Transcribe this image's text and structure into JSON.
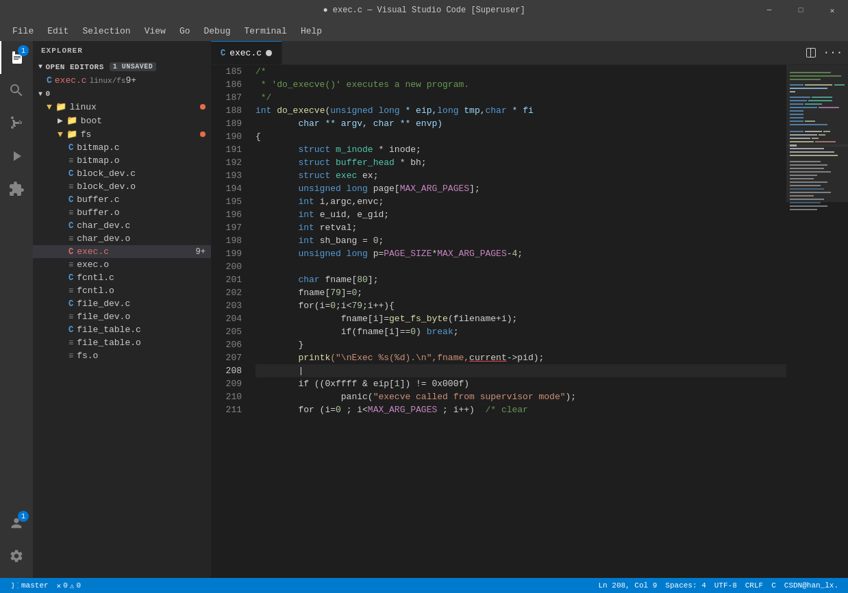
{
  "titlebar": {
    "title": "● exec.c — Visual Studio Code [Superuser]",
    "controls": [
      "minimize",
      "maximize",
      "close"
    ]
  },
  "menubar": {
    "items": [
      "File",
      "Edit",
      "Selection",
      "View",
      "Go",
      "Debug",
      "Terminal",
      "Help"
    ]
  },
  "activitybar": {
    "icons": [
      {
        "name": "explorer-icon",
        "glyph": "⎘",
        "active": true,
        "badge": "1"
      },
      {
        "name": "search-icon",
        "glyph": "🔍",
        "active": false
      },
      {
        "name": "source-control-icon",
        "glyph": "⑂",
        "active": false
      },
      {
        "name": "extensions-icon",
        "glyph": "⊞",
        "active": false
      },
      {
        "name": "remote-icon",
        "glyph": "⚙",
        "active": false
      }
    ],
    "bottom_icons": [
      {
        "name": "account-icon",
        "glyph": "👤",
        "badge": "1"
      },
      {
        "name": "settings-icon",
        "glyph": "⚙"
      }
    ]
  },
  "sidebar": {
    "title": "EXPLORER",
    "open_editors": {
      "label": "OPEN EDITORS",
      "badge": "1 UNSAVED",
      "items": [
        {
          "name": "exec.c",
          "path": "linux/fs",
          "modified": true,
          "unsaved_count": "9+"
        }
      ]
    },
    "tree": {
      "root": "0",
      "items": [
        {
          "level": 0,
          "type": "folder",
          "name": "linux",
          "expanded": true,
          "has_dot": true
        },
        {
          "level": 1,
          "type": "folder",
          "name": "boot",
          "expanded": false
        },
        {
          "level": 1,
          "type": "folder",
          "name": "fs",
          "expanded": true,
          "has_dot": true
        },
        {
          "level": 2,
          "type": "c-file",
          "name": "bitmap.c"
        },
        {
          "level": 2,
          "type": "o-file",
          "name": "bitmap.o"
        },
        {
          "level": 2,
          "type": "c-file",
          "name": "block_dev.c"
        },
        {
          "level": 2,
          "type": "o-file",
          "name": "block_dev.o"
        },
        {
          "level": 2,
          "type": "c-file",
          "name": "buffer.c"
        },
        {
          "level": 2,
          "type": "o-file",
          "name": "buffer.o"
        },
        {
          "level": 2,
          "type": "c-file",
          "name": "char_dev.c"
        },
        {
          "level": 2,
          "type": "o-file",
          "name": "char_dev.o"
        },
        {
          "level": 2,
          "type": "c-file",
          "name": "exec.c",
          "active": true,
          "unsaved_count": "9+"
        },
        {
          "level": 2,
          "type": "o-file",
          "name": "exec.o"
        },
        {
          "level": 2,
          "type": "c-file",
          "name": "fcntl.c"
        },
        {
          "level": 2,
          "type": "o-file",
          "name": "fcntl.o"
        },
        {
          "level": 2,
          "type": "c-file",
          "name": "file_dev.c"
        },
        {
          "level": 2,
          "type": "o-file",
          "name": "file_dev.o"
        },
        {
          "level": 2,
          "type": "c-file",
          "name": "file_table.c"
        },
        {
          "level": 2,
          "type": "o-file",
          "name": "file_table.o"
        },
        {
          "level": 2,
          "type": "o-file",
          "name": "fs.o"
        }
      ]
    }
  },
  "editor": {
    "tab": {
      "filename": "exec.c",
      "modified": true
    },
    "lines": [
      {
        "num": 185,
        "tokens": [
          {
            "text": "/*",
            "cls": "c-comment"
          }
        ]
      },
      {
        "num": 186,
        "tokens": [
          {
            "text": " * 'do_execve()' executes a new program.",
            "cls": "c-comment"
          }
        ]
      },
      {
        "num": 187,
        "tokens": [
          {
            "text": " */",
            "cls": "c-comment"
          }
        ]
      },
      {
        "num": 188,
        "tokens": [
          {
            "text": "int ",
            "cls": "c-keyword"
          },
          {
            "text": "do_execve",
            "cls": "c-function"
          },
          {
            "text": "(",
            "cls": ""
          },
          {
            "text": "unsigned long",
            "cls": "c-keyword"
          },
          {
            "text": " * eip,",
            "cls": "c-param"
          },
          {
            "text": "long",
            "cls": "c-keyword"
          },
          {
            "text": " tmp,",
            "cls": "c-param"
          },
          {
            "text": "char",
            "cls": "c-keyword"
          },
          {
            "text": " * fi",
            "cls": "c-param"
          }
        ]
      },
      {
        "num": 189,
        "tokens": [
          {
            "text": "        char ** argv, char ** envp)",
            "cls": "c-param"
          }
        ]
      },
      {
        "num": 190,
        "tokens": [
          {
            "text": "{",
            "cls": ""
          }
        ]
      },
      {
        "num": 191,
        "tokens": [
          {
            "text": "        struct ",
            "cls": "c-keyword"
          },
          {
            "text": "m_inode",
            "cls": "c-type"
          },
          {
            "text": " * inode;",
            "cls": ""
          }
        ]
      },
      {
        "num": 192,
        "tokens": [
          {
            "text": "        struct ",
            "cls": "c-keyword"
          },
          {
            "text": "buffer_head",
            "cls": "c-type"
          },
          {
            "text": " * bh;",
            "cls": ""
          }
        ]
      },
      {
        "num": 193,
        "tokens": [
          {
            "text": "        struct ",
            "cls": "c-keyword"
          },
          {
            "text": "exec",
            "cls": "c-type"
          },
          {
            "text": " ex;",
            "cls": ""
          }
        ]
      },
      {
        "num": 194,
        "tokens": [
          {
            "text": "        unsigned long ",
            "cls": "c-keyword"
          },
          {
            "text": "page[",
            "cls": ""
          },
          {
            "text": "MAX_ARG_PAGES",
            "cls": "c-macro"
          },
          {
            "text": "];",
            "cls": ""
          }
        ]
      },
      {
        "num": 195,
        "tokens": [
          {
            "text": "        int ",
            "cls": "c-keyword"
          },
          {
            "text": "i,argc,envc;",
            "cls": ""
          }
        ]
      },
      {
        "num": 196,
        "tokens": [
          {
            "text": "        int ",
            "cls": "c-keyword"
          },
          {
            "text": "e_uid, e_gid;",
            "cls": ""
          }
        ]
      },
      {
        "num": 197,
        "tokens": [
          {
            "text": "        int ",
            "cls": "c-keyword"
          },
          {
            "text": "retval;",
            "cls": ""
          }
        ]
      },
      {
        "num": 198,
        "tokens": [
          {
            "text": "        int ",
            "cls": "c-keyword"
          },
          {
            "text": "sh_bang = ",
            "cls": ""
          },
          {
            "text": "0",
            "cls": "c-number"
          },
          {
            "text": ";",
            "cls": ""
          }
        ]
      },
      {
        "num": 199,
        "tokens": [
          {
            "text": "        unsigned long ",
            "cls": "c-keyword"
          },
          {
            "text": "p=",
            "cls": ""
          },
          {
            "text": "PAGE_SIZE",
            "cls": "c-macro"
          },
          {
            "text": "*",
            "cls": ""
          },
          {
            "text": "MAX_ARG_PAGES",
            "cls": "c-macro"
          },
          {
            "text": "-",
            "cls": ""
          },
          {
            "text": "4",
            "cls": "c-number"
          },
          {
            "text": ";",
            "cls": ""
          }
        ]
      },
      {
        "num": 200,
        "tokens": [
          {
            "text": "",
            "cls": ""
          }
        ]
      },
      {
        "num": 201,
        "tokens": [
          {
            "text": "        char ",
            "cls": "c-keyword"
          },
          {
            "text": "fname[",
            "cls": ""
          },
          {
            "text": "80",
            "cls": "c-number"
          },
          {
            "text": "];",
            "cls": ""
          }
        ]
      },
      {
        "num": 202,
        "tokens": [
          {
            "text": "        fname[",
            "cls": ""
          },
          {
            "text": "79",
            "cls": "c-number"
          },
          {
            "text": "]=",
            "cls": ""
          },
          {
            "text": "0",
            "cls": "c-number"
          },
          {
            "text": ";",
            "cls": ""
          }
        ]
      },
      {
        "num": 203,
        "tokens": [
          {
            "text": "        for(i=",
            "cls": ""
          },
          {
            "text": "0",
            "cls": "c-number"
          },
          {
            "text": ";i<",
            "cls": ""
          },
          {
            "text": "79",
            "cls": "c-number"
          },
          {
            "text": ";i++){",
            "cls": ""
          }
        ]
      },
      {
        "num": 204,
        "tokens": [
          {
            "text": "                fname[i]=",
            "cls": ""
          },
          {
            "text": "get_fs_byte",
            "cls": "c-function"
          },
          {
            "text": "(filename+i);",
            "cls": ""
          }
        ]
      },
      {
        "num": 205,
        "tokens": [
          {
            "text": "                if(fname[i]==",
            "cls": ""
          },
          {
            "text": "0",
            "cls": "c-number"
          },
          {
            "text": ") break;",
            "cls": "c-keyword"
          }
        ]
      },
      {
        "num": 206,
        "tokens": [
          {
            "text": "        }",
            "cls": ""
          }
        ]
      },
      {
        "num": 207,
        "tokens": [
          {
            "text": "        ",
            "cls": ""
          },
          {
            "text": "printk",
            "cls": "c-function"
          },
          {
            "text": "(\"\\nExec %s(%d).\\n\",fname,",
            "cls": "c-string"
          },
          {
            "text": "current",
            "cls": "c-red-underline"
          },
          {
            "text": "->pid);",
            "cls": ""
          }
        ]
      },
      {
        "num": 208,
        "tokens": [
          {
            "text": "        |",
            "cls": ""
          }
        ]
      },
      {
        "num": 209,
        "tokens": [
          {
            "text": "        if ((0xffff & eip[",
            "cls": ""
          },
          {
            "text": "1",
            "cls": "c-number"
          },
          {
            "text": "]) != 0x000f)",
            "cls": ""
          }
        ]
      },
      {
        "num": 210,
        "tokens": [
          {
            "text": "                panic(\"execve called from supervisor mode\");",
            "cls": "c-function"
          }
        ]
      },
      {
        "num": 211,
        "tokens": [
          {
            "text": "        for (i=",
            "cls": ""
          },
          {
            "text": "0",
            "cls": "c-number"
          },
          {
            "text": " ; i<",
            "cls": ""
          },
          {
            "text": "MAX_ARG_PAGES",
            "cls": "c-macro"
          },
          {
            "text": " ; i++)  /* clear",
            "cls": "c-comment"
          }
        ]
      }
    ]
  },
  "statusbar": {
    "left": [
      {
        "text": "⎇ master"
      },
      {
        "text": "⚠ 0"
      },
      {
        "text": "✕ 0"
      }
    ],
    "right": [
      {
        "text": "Ln 208, Col 9"
      },
      {
        "text": "Spaces: 4"
      },
      {
        "text": "UTF-8"
      },
      {
        "text": "CRLF"
      },
      {
        "text": "C"
      },
      {
        "text": "CSDN@han_lx."
      }
    ]
  }
}
